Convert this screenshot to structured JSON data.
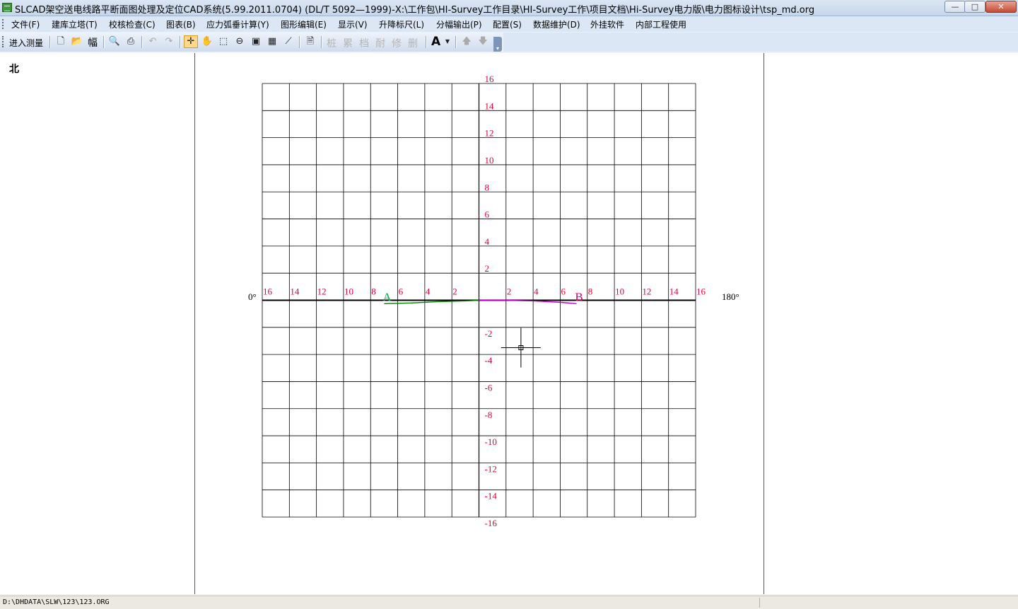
{
  "window": {
    "title": "SLCAD架空送电线路平断面图处理及定位CAD系统(5.99.2011.0704) (DL/T 5092—1999)-X:\\工作包\\HI-Survey工作目录\\HI-Survey工作\\项目文档\\Hi-Survey电力版\\电力图标设计\\tsp_md.org",
    "minimize": "—",
    "maximize": "□",
    "close": "✕"
  },
  "menu": [
    "文件(F)",
    "建库立塔(T)",
    "校核检查(C)",
    "图表(B)",
    "应力弧垂计算(Y)",
    "图形编辑(E)",
    "显示(V)",
    "升降标尺(L)",
    "分幅输出(P)",
    "配置(S)",
    "数据维护(D)",
    "外挂软件",
    "内部工程使用"
  ],
  "toolbar": {
    "enter_survey": "进入测量",
    "frame_label": "幅",
    "disabled_chars": [
      "桩",
      "累",
      "档",
      "耐",
      "修",
      "删"
    ],
    "text_tool": "A",
    "icons": [
      "new-file-icon",
      "open-folder-icon",
      "print-preview-icon",
      "print-icon",
      "undo-icon",
      "redo-icon",
      "pointer-icon",
      "pan-hand-icon",
      "zoom-window-icon",
      "zoom-out-icon",
      "zoom-extents-icon",
      "grid-icon",
      "measure-icon",
      "document-icon",
      "arrow-up-icon",
      "arrow-down-icon"
    ]
  },
  "left_pane": {
    "north_label": "北"
  },
  "chart_data": {
    "type": "polar-grid",
    "x_ticks_left": [
      "16",
      "14",
      "12",
      "10",
      "8",
      "6",
      "4",
      "2"
    ],
    "x_ticks_right": [
      "2",
      "4",
      "6",
      "8",
      "10",
      "12",
      "14",
      "16"
    ],
    "y_ticks_positive": [
      "16",
      "14",
      "12",
      "10",
      "8",
      "6",
      "4",
      "2"
    ],
    "y_ticks_negative": [
      "-2",
      "-4",
      "-6",
      "-8",
      "-10",
      "-12",
      "-14",
      "-16"
    ],
    "xlim": [
      -16,
      16
    ],
    "ylim": [
      -16,
      16
    ],
    "grid": true,
    "angle_left": "0°",
    "angle_right": "180°",
    "point_a_label": "A",
    "point_b_label": "B",
    "series": [
      {
        "color": "#008000",
        "x": [
          -7,
          -5,
          -3,
          -1,
          0
        ],
        "y": [
          -0.25,
          -0.2,
          -0.1,
          -0.05,
          0
        ]
      },
      {
        "color": "#c000c0",
        "x": [
          0,
          2,
          4,
          6,
          7.2
        ],
        "y": [
          0,
          0,
          -0.05,
          -0.15,
          -0.25
        ]
      }
    ],
    "cursor": {
      "x": 3.1,
      "y": -3.5
    },
    "colors": {
      "tick_label": "#e0003c",
      "point_a": "#00b050",
      "point_b": "#e0007a",
      "grid": "#000000"
    }
  },
  "status": {
    "path": "D:\\DHDATA\\SLW\\123\\123.ORG"
  }
}
